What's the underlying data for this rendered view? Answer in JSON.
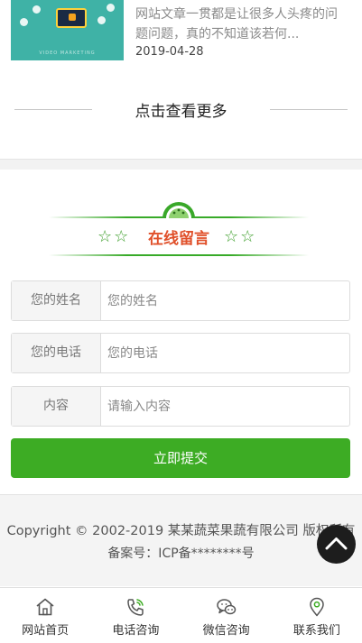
{
  "article": {
    "excerpt": "网站文章一贯都是让很多人头疼的问题问题，真的不知道该若何...",
    "date": "2019-04-28",
    "thumb_caption": "VIDEO MARKETING"
  },
  "more_link": "点击查看更多",
  "message": {
    "title": "在线留言",
    "stars_left": "☆☆",
    "stars_right": "☆☆",
    "fields": [
      {
        "label": "您的姓名",
        "placeholder": "您的姓名"
      },
      {
        "label": "您的电话",
        "placeholder": "您的电话"
      },
      {
        "label": "内容",
        "placeholder": "请输入内容"
      }
    ],
    "submit_label": "立即提交"
  },
  "footer": {
    "copyright": "Copyright © 2002-2019 某某蔬菜果蔬有限公司 版权所有",
    "icp": "备案号：ICP备********号"
  },
  "tabbar": [
    {
      "label": "网站首页",
      "icon": "home-icon"
    },
    {
      "label": "电话咨询",
      "icon": "phone-icon"
    },
    {
      "label": "微信咨询",
      "icon": "wechat-icon"
    },
    {
      "label": "联系我们",
      "icon": "location-icon"
    }
  ],
  "colors": {
    "accent_green": "#3dac24",
    "title_orange": "#e0502a"
  }
}
